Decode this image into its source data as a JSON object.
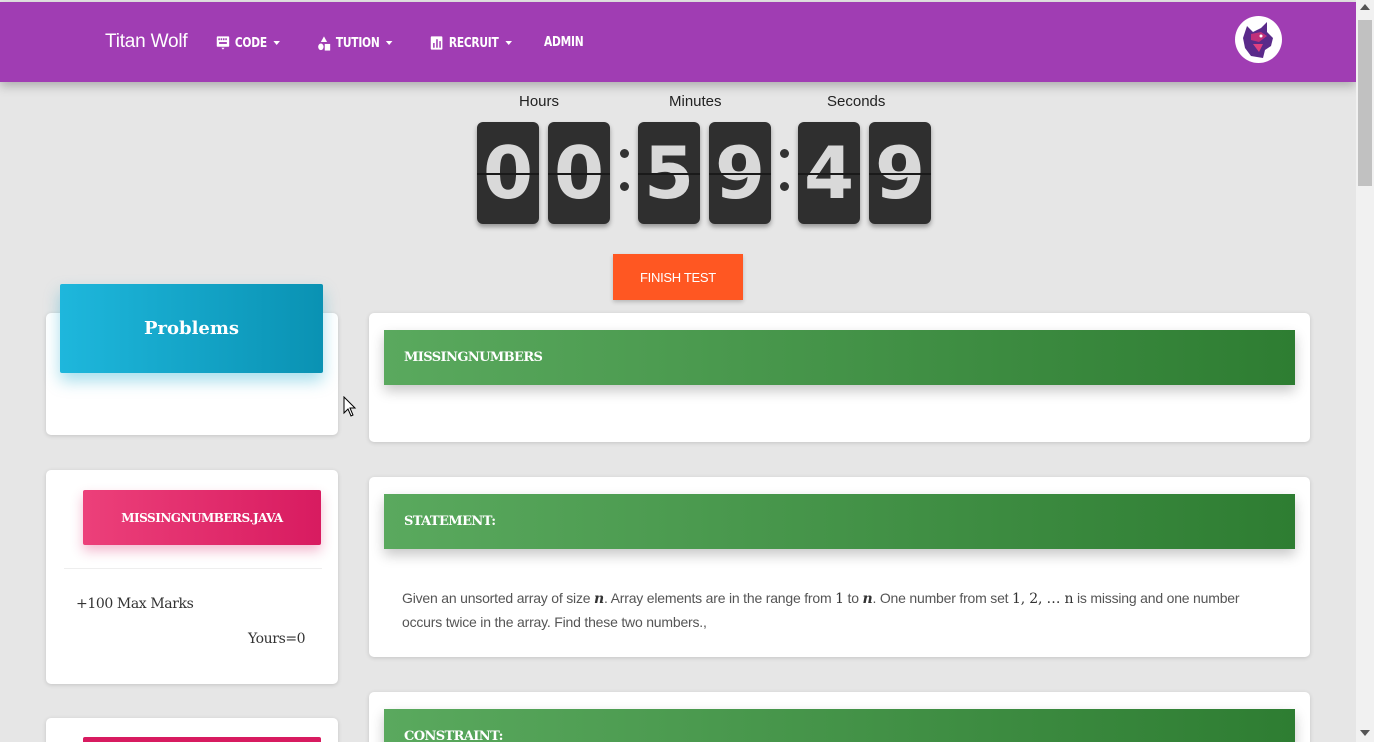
{
  "navbar": {
    "brand": "Titan Wolf",
    "items": [
      {
        "label": "CODE",
        "icon": "keyboard-icon",
        "dropdown": true
      },
      {
        "label": "TUTION",
        "icon": "shapes-icon",
        "dropdown": true
      },
      {
        "label": "RECRUIT",
        "icon": "chart-icon",
        "dropdown": true
      },
      {
        "label": "ADMIN",
        "dropdown": false
      }
    ],
    "avatar_icon": "wolf-logo-icon",
    "color": "#a03db3"
  },
  "timer": {
    "hours_label": "Hours",
    "minutes_label": "Minutes",
    "seconds_label": "Seconds",
    "digits": [
      "0",
      "0",
      "5",
      "9",
      "4",
      "9"
    ]
  },
  "finish_button": "FINISH TEST",
  "sidebar": {
    "problems_title": "Problems",
    "problem_file": "MISSINGNUMBERS.JAVA",
    "max_marks": "+100 Max Marks",
    "yours": "Yours=0"
  },
  "main": {
    "problem_title": "MISSINGNUMBERS",
    "statement_header": "STATEMENT:",
    "statement_parts": {
      "p1": "Given an unsorted array of size ",
      "n1": "n",
      "p2": ". Array elements are in the range from ",
      "one": "1",
      "p3": " to ",
      "n2": "n",
      "p4": ". One number from set ",
      "set": "1, 2, … n",
      "p5": " is missing and one number occurs twice in the array. Find these two numbers.,"
    },
    "constraint_header": "CONSTRAINT:"
  }
}
